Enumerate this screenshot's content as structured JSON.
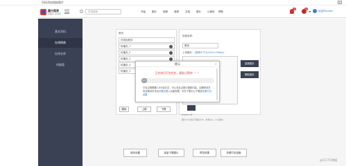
{
  "window": {
    "title": "页码添加相册图片",
    "close": "×"
  },
  "topbar": {
    "logo_name": "魔方图表",
    "logo_sub": "多图表·多场景",
    "search_placeholder": "在线搜索",
    "nav": [
      "开始",
      "图片",
      "视频",
      "音频",
      "文档",
      "图片",
      "小程序",
      "帮助"
    ],
    "bell_count": "3",
    "avatar_count": "4",
    "user_name": "欢迎你ILewis"
  },
  "sidebar": {
    "items": [
      {
        "label": "基本资料",
        "active": false
      },
      {
        "label": "在线网商",
        "active": true
      },
      {
        "label": "在线仓库",
        "active": false
      },
      {
        "label": "电脑管",
        "active": false
      }
    ]
  },
  "left_panel": {
    "crumb": "首页",
    "rows": [
      {
        "label": "在线相册页",
        "dot": false
      },
      {
        "label": "轮播页_1",
        "dot": true
      },
      {
        "label": "轮播页_2",
        "dot": true
      },
      {
        "label": "轮播页_3",
        "dot": true
      },
      {
        "label": "轮播页_4",
        "dot": true
      },
      {
        "label": "轮播页_5",
        "dot": true
      }
    ],
    "buttons": {
      "delete": "删除",
      "up": "上移",
      "down": "下移"
    }
  },
  "right_panel": {
    "name_label": "页面名称：",
    "name_value": "首页",
    "upload_label": "上传图片：",
    "upload_link": "(推荐尺寸为1024×768px)",
    "select_image": "选择图片",
    "delete_image": "删除图片",
    "image_file": "frame.rtf",
    "tip": "图片大小建议不超过1M，支持jpg、png格式"
  },
  "dialog": {
    "title": "提示",
    "close": "×",
    "warning": "正在执行打包任务，请耐心等待！！！",
    "progress": 0.08,
    "progress_label": "8%",
    "note": "打包过程需要1-6分钟左右，可以在此过程中更新内容，如需修改打包设置请在本页",
    "note_link": "设置页",
    "note_tail": "进入页面查看，可在下载中心下载或",
    "note_link2": "查看打包结果"
  },
  "bottom_buttons": [
    "保存设置",
    "批量下载图片",
    "预览效果",
    "查看打包进度"
  ],
  "watermark": "@51CTO博客"
}
